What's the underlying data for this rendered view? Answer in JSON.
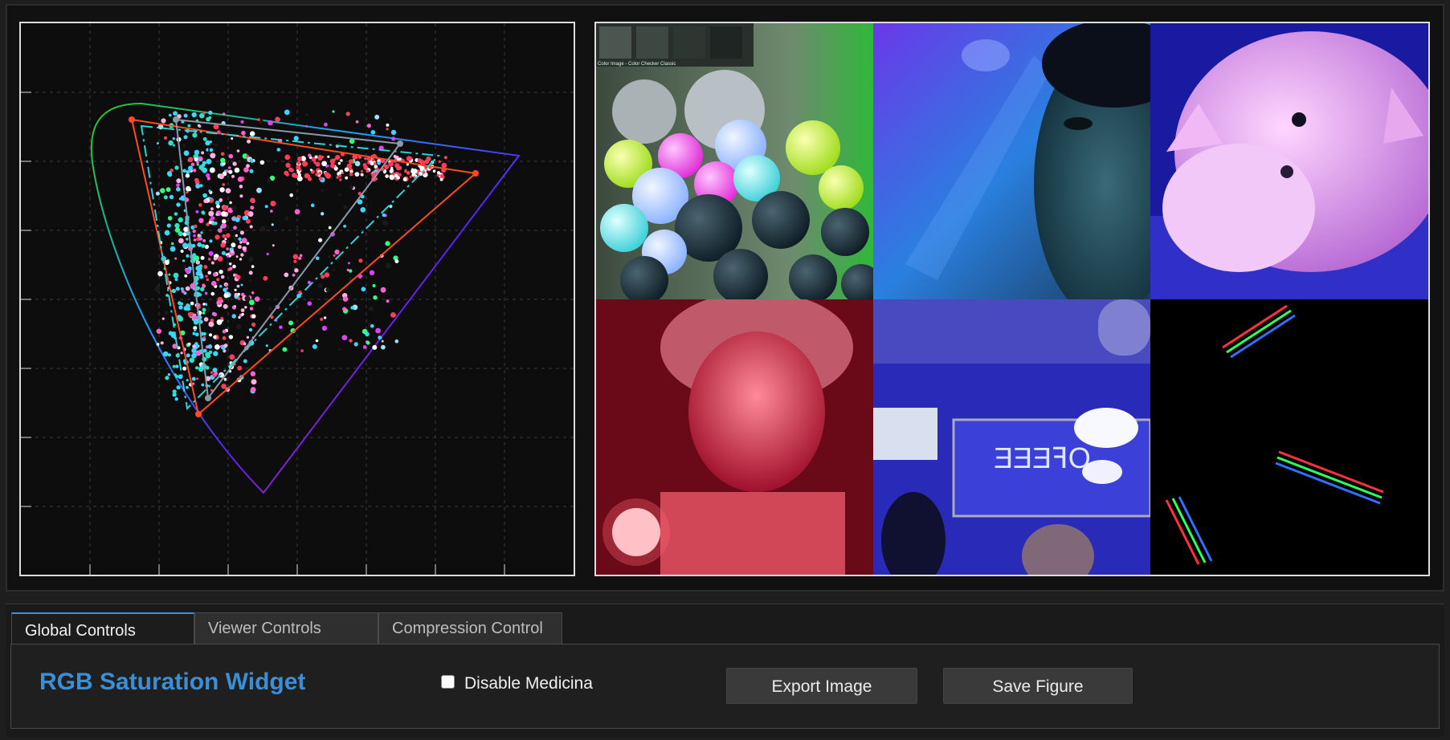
{
  "tabs": [
    {
      "label": "Global Controls"
    },
    {
      "label": "Viewer Controls"
    },
    {
      "label": "Compression Control"
    }
  ],
  "widget": {
    "title": "RGB Saturation Widget",
    "checkbox_label": "Disable Medicina",
    "checkbox_checked": false,
    "export_button": "Export Image",
    "save_button": "Save Figure"
  },
  "colors": {
    "accent": "#3b8fd6",
    "gamut_outer": "#ff4a22",
    "gamut_dashed": "#29d6d6",
    "gamut_inner": "#8a9aa8"
  },
  "viewer": {
    "tiles": [
      {
        "subject": "glowing-spheres",
        "overlay_text": "Color Image - Color Checker Classic"
      },
      {
        "subject": "blue-lit-portrait"
      },
      {
        "subject": "pink-plush-pig"
      },
      {
        "subject": "red-lit-portrait"
      },
      {
        "subject": "neon-coffee-bar"
      },
      {
        "subject": "spectral-light-streaks"
      }
    ]
  }
}
